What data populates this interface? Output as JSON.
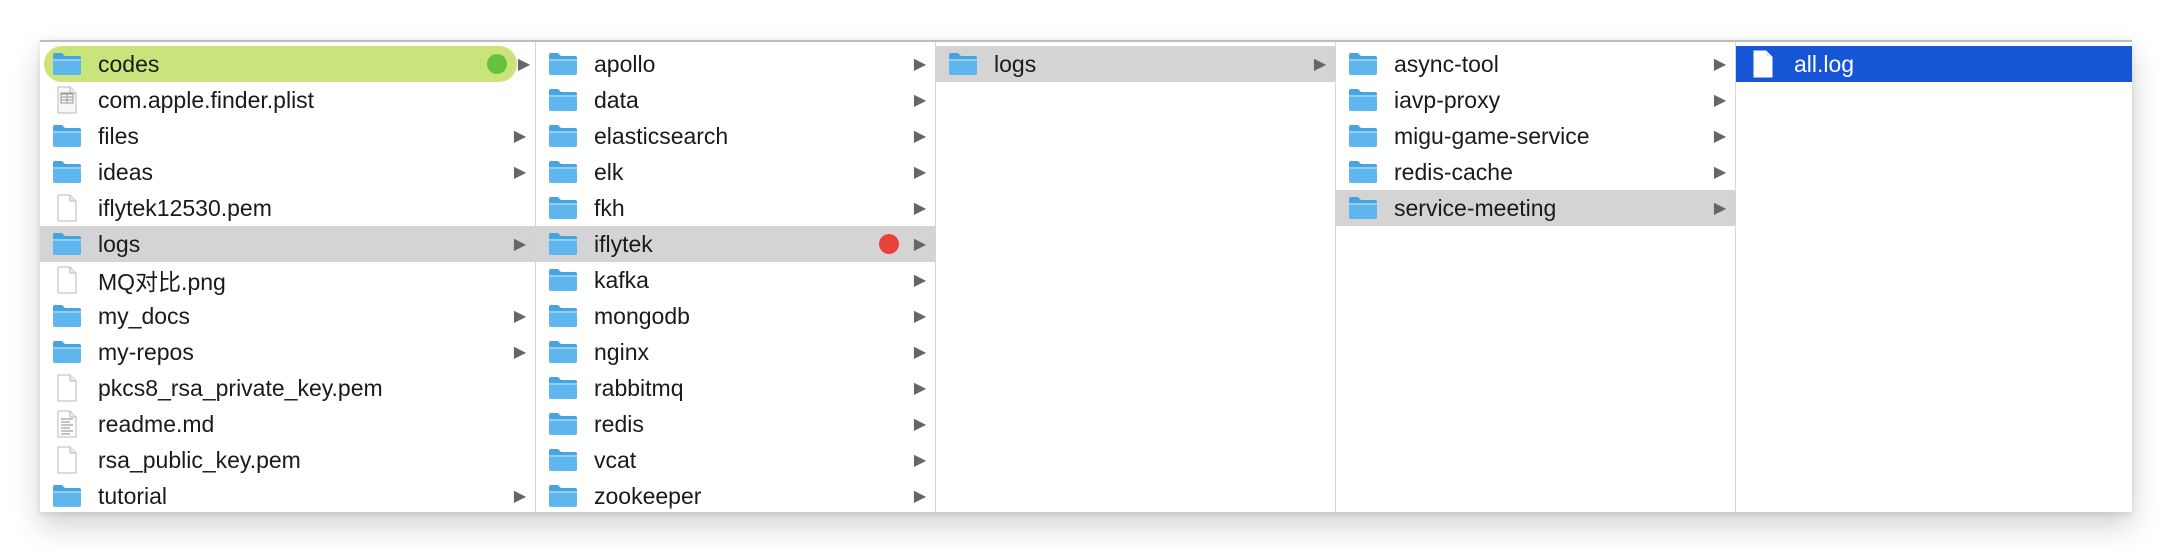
{
  "colors": {
    "selection_active": "#1555d6",
    "selection_path": "#d4d4d4",
    "tag_green_background": "#c9e47a",
    "tag_green": "#66c23a",
    "tag_red": "#e8433b",
    "folder_blue": "#5fb6ef"
  },
  "columns": [
    {
      "items": [
        {
          "label": "codes",
          "icon": "folder-icon",
          "chevron": true,
          "state": "tagged-green",
          "tag": "green"
        },
        {
          "label": "com.apple.finder.plist",
          "icon": "plist-file-icon",
          "chevron": false
        },
        {
          "label": "files",
          "icon": "folder-icon",
          "chevron": true
        },
        {
          "label": "ideas",
          "icon": "folder-icon",
          "chevron": true
        },
        {
          "label": "iflytek12530.pem",
          "icon": "file-icon",
          "chevron": false
        },
        {
          "label": "logs",
          "icon": "folder-icon",
          "chevron": true,
          "state": "path"
        },
        {
          "label": "MQ对比.png",
          "icon": "file-icon",
          "chevron": false
        },
        {
          "label": "my_docs",
          "icon": "folder-icon",
          "chevron": true
        },
        {
          "label": "my-repos",
          "icon": "folder-icon",
          "chevron": true
        },
        {
          "label": "pkcs8_rsa_private_key.pem",
          "icon": "file-icon",
          "chevron": false
        },
        {
          "label": "readme.md",
          "icon": "text-file-icon",
          "chevron": false
        },
        {
          "label": "rsa_public_key.pem",
          "icon": "file-icon",
          "chevron": false
        },
        {
          "label": "tutorial",
          "icon": "folder-icon",
          "chevron": true
        }
      ]
    },
    {
      "items": [
        {
          "label": "apollo",
          "icon": "folder-icon",
          "chevron": true
        },
        {
          "label": "data",
          "icon": "folder-icon",
          "chevron": true
        },
        {
          "label": "elasticsearch",
          "icon": "folder-icon",
          "chevron": true
        },
        {
          "label": "elk",
          "icon": "folder-icon",
          "chevron": true
        },
        {
          "label": "fkh",
          "icon": "folder-icon",
          "chevron": true
        },
        {
          "label": "iflytek",
          "icon": "folder-icon",
          "chevron": true,
          "state": "path",
          "tag": "red"
        },
        {
          "label": "kafka",
          "icon": "folder-icon",
          "chevron": true
        },
        {
          "label": "mongodb",
          "icon": "folder-icon",
          "chevron": true
        },
        {
          "label": "nginx",
          "icon": "folder-icon",
          "chevron": true
        },
        {
          "label": "rabbitmq",
          "icon": "folder-icon",
          "chevron": true
        },
        {
          "label": "redis",
          "icon": "folder-icon",
          "chevron": true
        },
        {
          "label": "vcat",
          "icon": "folder-icon",
          "chevron": true
        },
        {
          "label": "zookeeper",
          "icon": "folder-icon",
          "chevron": true
        }
      ]
    },
    {
      "items": [
        {
          "label": "logs",
          "icon": "folder-icon",
          "chevron": true,
          "state": "path"
        }
      ]
    },
    {
      "items": [
        {
          "label": "async-tool",
          "icon": "folder-icon",
          "chevron": true
        },
        {
          "label": "iavp-proxy",
          "icon": "folder-icon",
          "chevron": true
        },
        {
          "label": "migu-game-service",
          "icon": "folder-icon",
          "chevron": true
        },
        {
          "label": "redis-cache",
          "icon": "folder-icon",
          "chevron": true
        },
        {
          "label": "service-meeting",
          "icon": "folder-icon",
          "chevron": true,
          "state": "path"
        }
      ]
    },
    {
      "items": [
        {
          "label": "all.log",
          "icon": "file-icon",
          "chevron": false,
          "state": "active"
        }
      ]
    }
  ]
}
